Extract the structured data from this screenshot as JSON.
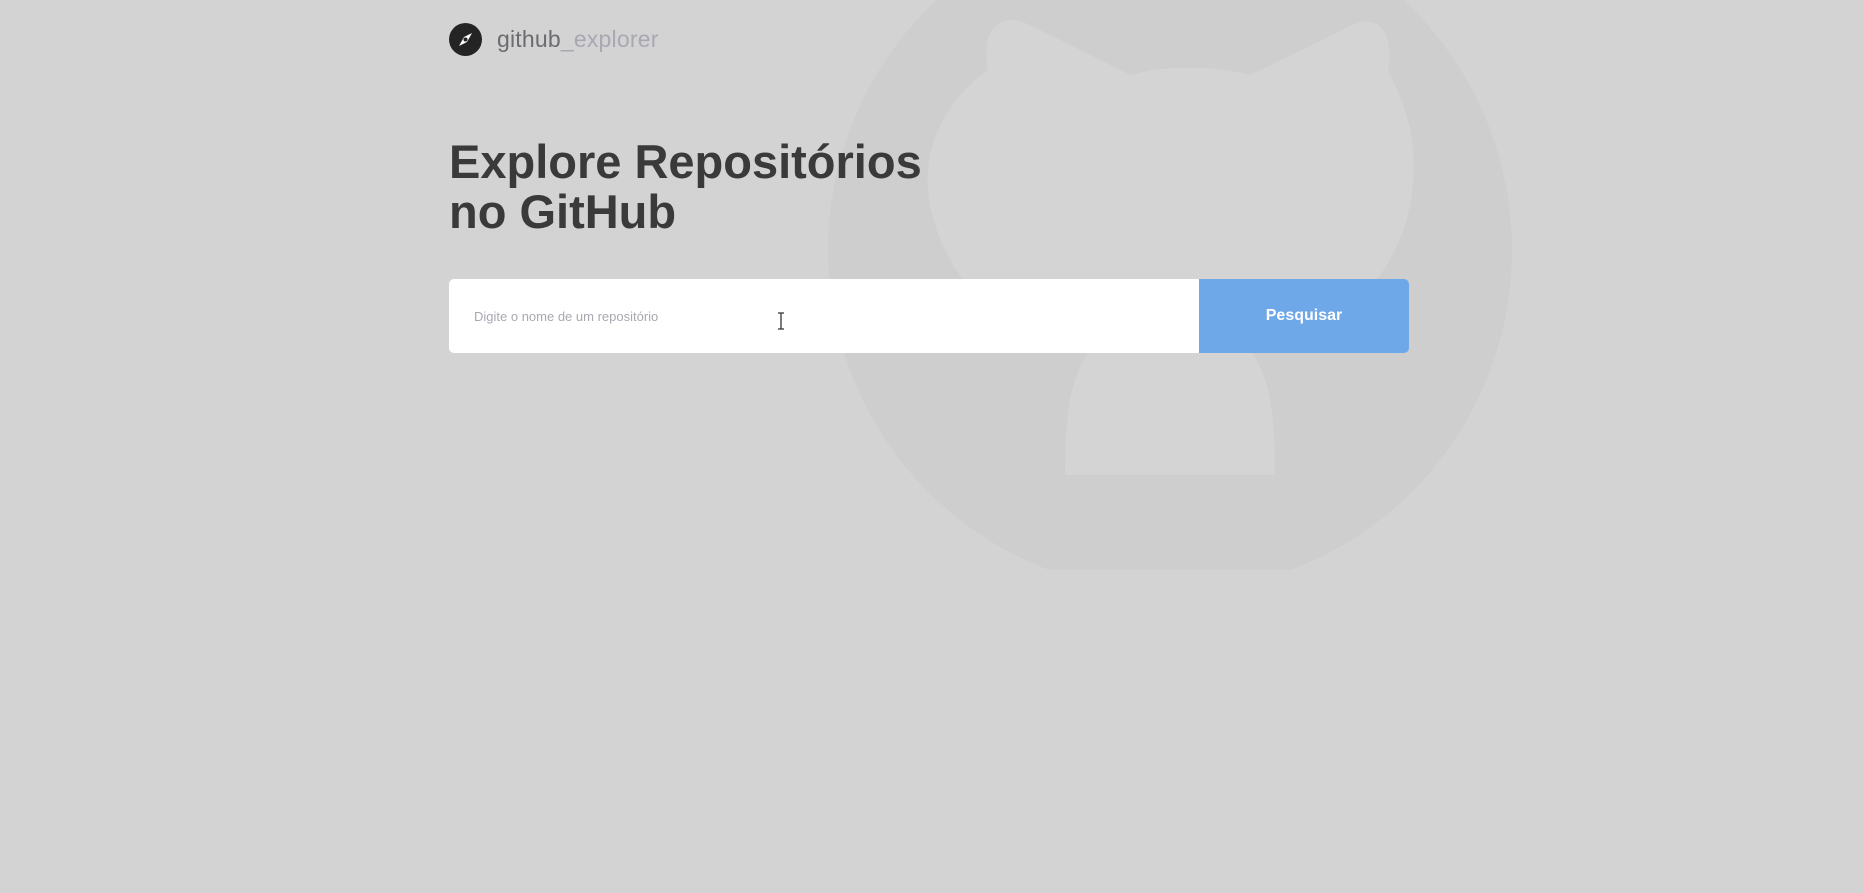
{
  "logo": {
    "icon": "compass-icon",
    "brand_prefix": "github",
    "brand_suffix": "_explorer"
  },
  "title": {
    "line1": "Explore Repositórios",
    "line2": "no GitHub"
  },
  "search": {
    "placeholder": "Digite o nome de um repositório",
    "value": "",
    "button_label": "Pesquisar"
  },
  "background": {
    "icon": "github-octocat-icon"
  },
  "colors": {
    "page_background": "#d3d3d3",
    "title": "#3a3a3a",
    "button": "#6ea8e8",
    "input_background": "#ffffff",
    "muted_text": "#a8a8b3"
  }
}
